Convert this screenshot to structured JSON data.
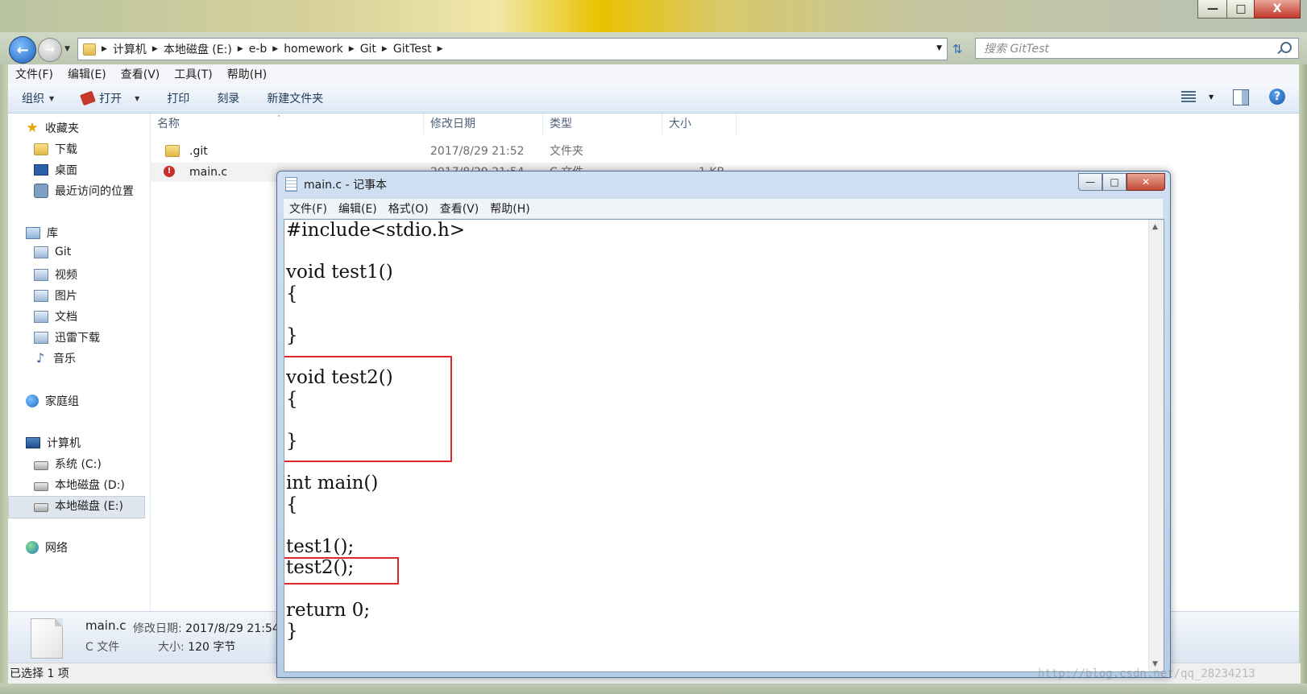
{
  "window": {
    "minimize": "—",
    "maximize": "□",
    "close": "X"
  },
  "address": {
    "breadcrumbs": [
      "计算机",
      "本地磁盘 (E:)",
      "e-b",
      "homework",
      "Git",
      "GitTest"
    ],
    "search_placeholder": "搜索 GitTest"
  },
  "menubar": [
    "文件(F)",
    "编辑(E)",
    "查看(V)",
    "工具(T)",
    "帮助(H)"
  ],
  "toolbar": {
    "organize": "组织",
    "open": "打开",
    "print": "打印",
    "burn": "刻录",
    "new_folder": "新建文件夹"
  },
  "nav": {
    "favorites": "收藏夹",
    "downloads": "下载",
    "desktop": "桌面",
    "recent": "最近访问的位置",
    "libraries": "库",
    "lib_git": "Git",
    "lib_video": "视频",
    "lib_pictures": "图片",
    "lib_docs": "文档",
    "lib_thunder": "迅雷下载",
    "lib_music": "音乐",
    "homegroup": "家庭组",
    "computer": "计算机",
    "drive_c": "系统 (C:)",
    "drive_d": "本地磁盘 (D:)",
    "drive_e": "本地磁盘 (E:)",
    "network": "网络"
  },
  "columns": {
    "name": "名称",
    "modified": "修改日期",
    "type": "类型",
    "size": "大小"
  },
  "files": [
    {
      "name": ".git",
      "modified": "2017/8/29 21:52",
      "type": "文件夹",
      "size": ""
    },
    {
      "name": "main.c",
      "modified": "2017/8/29 21:54",
      "type": "C 文件",
      "size": "1 KB"
    }
  ],
  "details": {
    "name": "main.c",
    "modified_label": "修改日期:",
    "modified_value": "2017/8/29 21:54",
    "type": "C 文件",
    "size_label": "大小:",
    "size_value": "120 字节"
  },
  "status": "已选择 1 项",
  "notepad": {
    "title": "main.c - 记事本",
    "menu": [
      "文件(F)",
      "编辑(E)",
      "格式(O)",
      "查看(V)",
      "帮助(H)"
    ],
    "code_lines": [
      "#include<stdio.h>",
      "",
      "void test1()",
      "{",
      "",
      "}",
      "",
      "void test2()",
      "{",
      "",
      "}",
      "",
      "int main()",
      "{",
      "",
      "test1();",
      "test2();",
      "",
      "return 0;",
      "}"
    ],
    "highlight_color": "#e0262a"
  },
  "watermark": "http://blog.csdn.net/qq_28234213"
}
